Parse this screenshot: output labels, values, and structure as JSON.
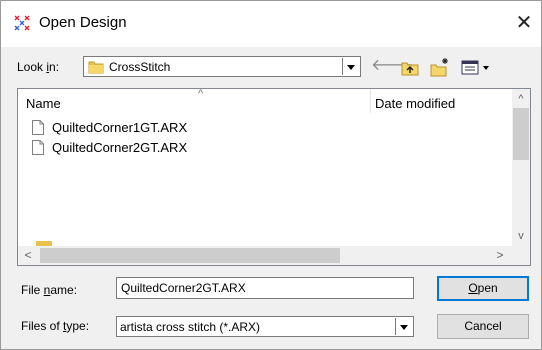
{
  "window": {
    "title": "Open Design",
    "icon": "cross-stitch-app-icon"
  },
  "toolbar": {
    "look_in_label": "Look in:",
    "look_in_value": "CrossStitch",
    "back_icon": "back-arrow-icon",
    "up_icon": "up-folder-icon",
    "new_folder_icon": "new-folder-icon",
    "view_icon": "view-menu-icon"
  },
  "file_list": {
    "columns": [
      "Name",
      "Date modified"
    ],
    "files": [
      {
        "name": "QuiltedCorner1GT.ARX"
      },
      {
        "name": "QuiltedCorner2GT.ARX"
      }
    ]
  },
  "footer": {
    "file_name_label": "File name:",
    "file_name_value": "QuiltedCorner2GT.ARX",
    "file_type_label": "Files of type:",
    "file_type_value": "artista cross stitch (*.ARX)",
    "open_label": "Open",
    "cancel_label": "Cancel"
  },
  "colors": {
    "accent": "#0078d7",
    "folder": "#e7c24e"
  }
}
